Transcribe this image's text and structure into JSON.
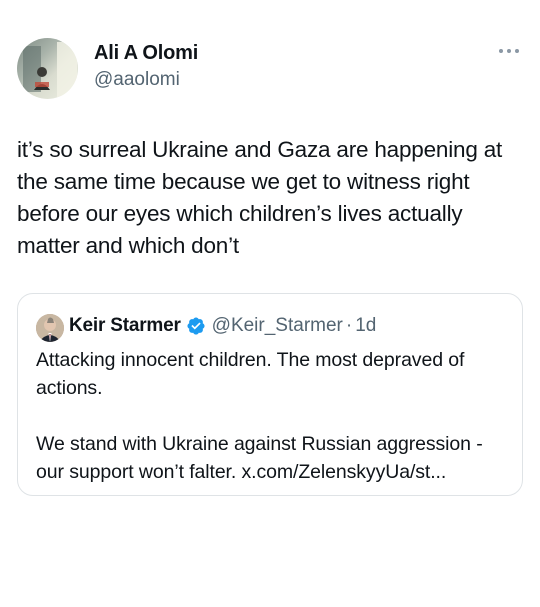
{
  "tweet": {
    "author": {
      "name": "Ali A Olomi",
      "handle": "@aaolomi"
    },
    "text": "it’s so surreal Ukraine and Gaza are happening at the same time because we get to witness right before our eyes which children’s lives actually matter and which don’t",
    "more_icon": "more-horizontal-icon"
  },
  "quoted_tweet": {
    "author": {
      "name": "Keir Starmer",
      "verified_icon": "verified-badge-icon",
      "handle": "@Keir_Starmer",
      "separator": "·",
      "time": "1d"
    },
    "text": "Attacking innocent children. The most depraved of actions.\n\nWe stand with Ukraine against Russian aggression - our support won’t falter. x.com/ZelenskyyUa/st..."
  },
  "colors": {
    "text_primary": "#0f1419",
    "text_secondary": "#536471",
    "border": "#dfe3e6",
    "verified_badge": "#1d9bf0"
  }
}
